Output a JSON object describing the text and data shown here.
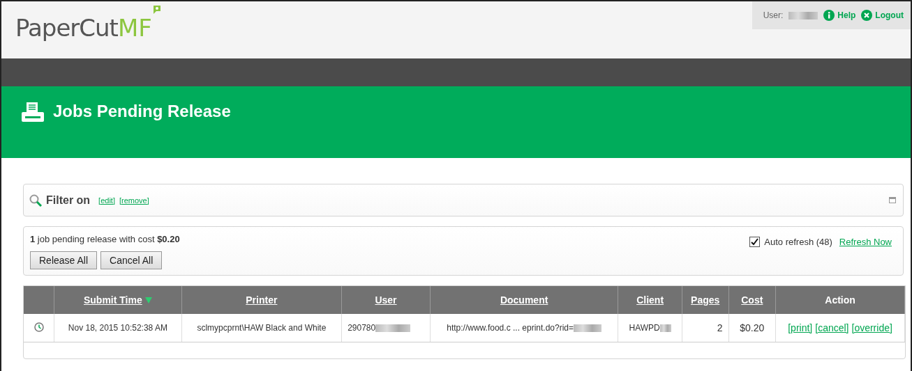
{
  "header": {
    "logo_main": "PaperCut",
    "logo_accent": "MF",
    "user_label": "User:",
    "links": [
      {
        "kind": "help",
        "label": "Help"
      },
      {
        "kind": "logout",
        "label": "Logout"
      }
    ]
  },
  "banner": {
    "title": "Jobs Pending Release"
  },
  "filter": {
    "label": "Filter on",
    "links": [
      "[edit]",
      "[remove]"
    ]
  },
  "summary": {
    "text": "**1** job pending release with cost **$0.20**",
    "buttons": [
      "Release All",
      "Cancel All"
    ],
    "auto_refresh": {
      "label": "Auto refresh (48)",
      "checked": true
    },
    "refresh_link": "Refresh Now"
  },
  "table": {
    "columns": [
      {
        "label": "Submit Time",
        "sortable": true,
        "sorted": true
      },
      {
        "label": "Printer",
        "sortable": true,
        "sorted": false
      },
      {
        "label": "User",
        "sortable": true,
        "sorted": false
      },
      {
        "label": "Document",
        "sortable": true,
        "sorted": false
      },
      {
        "label": "Client",
        "sortable": true,
        "sorted": false
      },
      {
        "label": "Pages",
        "sortable": true,
        "sorted": false
      },
      {
        "label": "Cost",
        "sortable": true,
        "sorted": false
      },
      {
        "label": "Action",
        "sortable": false,
        "sorted": false
      }
    ],
    "rows": [
      {
        "submit_time": "Nov 18, 2015 10:52:38 AM",
        "printer": "sclmypcprnt\\HAW Black and White",
        "user": "290780",
        "document": "http://www.food.c ... eprint.do?rid=",
        "client": "HAWPD",
        "pages": "2",
        "cost": "$0.20",
        "actions": [
          "[print]",
          "[cancel]",
          "[override]"
        ]
      }
    ]
  }
}
